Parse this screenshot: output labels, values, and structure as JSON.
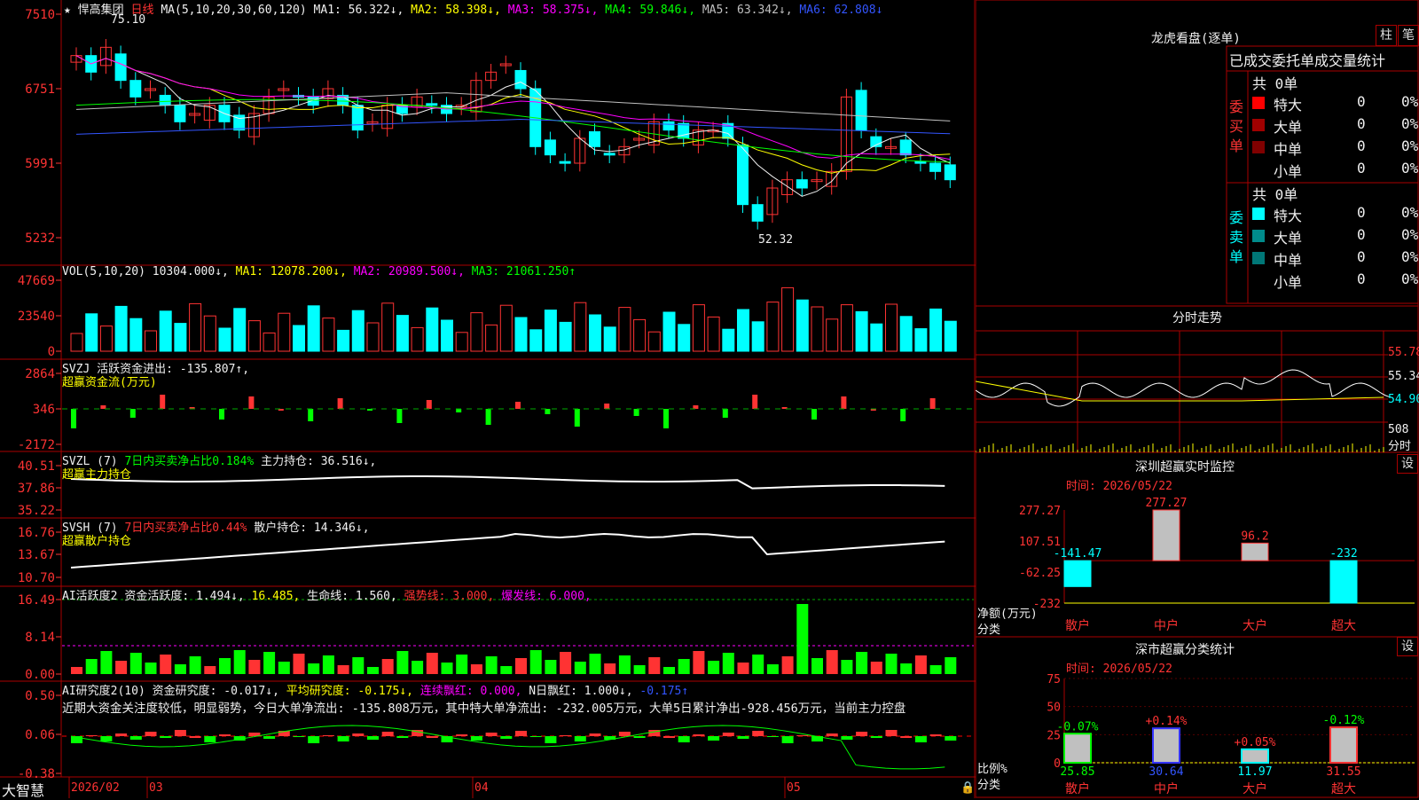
{
  "main_header": {
    "star": "★",
    "stock_name": "悍高集团",
    "period": "日线",
    "ma_label": "MA(5,10,20,30,60,120)",
    "ma_values": [
      {
        "label": "MA1: 56.322↓,",
        "color": "#f0f0f0"
      },
      {
        "label": "MA2: 58.398↓,",
        "color": "#ffff00"
      },
      {
        "label": "MA3: 58.375↓,",
        "color": "#ff00ff"
      },
      {
        "label": "MA4: 59.846↓,",
        "color": "#00ff00"
      },
      {
        "label": "MA5: 63.342↓,",
        "color": "#c0c0c0"
      },
      {
        "label": "MA6: 62.808↓",
        "color": "#3355ff"
      }
    ],
    "high_mark": "75.10",
    "low_mark": "52.32",
    "y_ticks": [
      "7510",
      "6751",
      "5991",
      "5232"
    ]
  },
  "vol_panel": {
    "label": "VOL(5,10,20)",
    "value": "10304.000↓,",
    "ma1": "MA1: 12078.200↓,",
    "ma2": "MA2: 20989.500↓,",
    "ma3": "MA3: 21061.250↑",
    "y_ticks": [
      "47669",
      "23540",
      "0"
    ]
  },
  "svzj_panel": {
    "label": "SVZJ",
    "text": "活跃资金进出: -135.807↑,",
    "subtitle": "超赢资金流(万元)",
    "y_ticks": [
      "2864",
      "346",
      "-2172"
    ]
  },
  "svzl_panel": {
    "label": "SVZL (7)",
    "ratio": "7日内买卖净占比0.184%",
    "hold": "主力持仓: 36.516↓,",
    "subtitle": "超赢主力持仓",
    "y_ticks": [
      "40.51",
      "37.86",
      "35.22"
    ]
  },
  "svsh_panel": {
    "label": "SVSH (7)",
    "ratio": "7日内买卖净占比0.44%",
    "hold": "散户持仓: 14.346↓,",
    "subtitle": "超赢散户持仓",
    "y_ticks": [
      "16.76",
      "13.67",
      "10.70"
    ]
  },
  "ai_act_panel": {
    "label": "AI活跃度2",
    "a": "资金活跃度: 1.494↓,",
    "b": "16.485,",
    "c": "生命线: 1.560,",
    "d": "强势线: 3.000,",
    "e": "爆发线: 6.000,",
    "y_ticks": [
      "16.49",
      "8.14",
      "0.00"
    ]
  },
  "ai_res_panel": {
    "label": "AI研究度2(10)",
    "a": "资金研究度: -0.017↓,",
    "b": "平均研究度: -0.175↓,",
    "c": "连续飘红: 0.000,",
    "d": "N日飘红: 1.000↓,",
    "e": "-0.175↑",
    "summary": "近期大资金关注度较低，明显弱势，今日大单净流出: -135.808万元，其中特大单净流出: -232.005万元，大单5日累计净出-928.456万元，当前主力控盘",
    "y_ticks": [
      "0.50",
      "0.06",
      "-0.38"
    ]
  },
  "bottom_bar": {
    "brand": "大智慧",
    "dates": [
      "2026/02",
      "03",
      "04",
      "05"
    ]
  },
  "right": {
    "title": "龙虎看盘(逐单)",
    "btn1": "柱",
    "btn2": "笔",
    "section_title": "已成交委托单成交量统计",
    "buy_label": "委买单",
    "buy_total": "共 0单",
    "sell_label": "委卖单",
    "sell_total": "共 0单",
    "buy_rows": [
      {
        "name": "特大",
        "count": "0",
        "pct": "0%",
        "color": "#ff0000"
      },
      {
        "name": "大单",
        "count": "0",
        "pct": "0%",
        "color": "#a00000"
      },
      {
        "name": "中单",
        "count": "0",
        "pct": "0%",
        "color": "#800000"
      },
      {
        "name": "小单",
        "count": "0",
        "pct": "0%",
        "color": "#000000"
      }
    ],
    "sell_rows": [
      {
        "name": "特大",
        "count": "0",
        "pct": "0%",
        "color": "#00ffff"
      },
      {
        "name": "大单",
        "count": "0",
        "pct": "0%",
        "color": "#008b8b"
      },
      {
        "name": "中单",
        "count": "0",
        "pct": "0%",
        "color": "#007777"
      },
      {
        "name": "小单",
        "count": "0",
        "pct": "0%",
        "color": "#000000"
      }
    ],
    "intraday_title": "分时走势",
    "intraday_ticks": [
      "55.78",
      "55.34",
      "54.90",
      "508",
      "分时"
    ],
    "sz_monitor_title": "深圳超赢实时监控",
    "sz_monitor_btn": "设",
    "sz_time": "时间: 2026/05/22",
    "sz_yticks": [
      "277.27",
      "107.51",
      "-62.25",
      "-232"
    ],
    "sz_ylabel": "净额(万元)",
    "sz_xlabel": "分类",
    "sz_values": [
      "-141.47",
      "277.27",
      "96.2",
      "-232"
    ],
    "sz_cats": [
      "散户",
      "中户",
      "大户",
      "超大"
    ],
    "stat_title": "深市超赢分类统计",
    "stat_btn": "设",
    "stat_time": "时间: 2026/05/22",
    "stat_yticks": [
      "75",
      "50",
      "25",
      "0"
    ],
    "stat_ylabel": "比例%",
    "stat_xlabel": "分类",
    "stat_changes": [
      "-0.07%",
      "+0.14%",
      "+0.05%",
      "-0.12%"
    ],
    "stat_values": [
      "25.85",
      "30.64",
      "11.97",
      "31.55"
    ],
    "stat_cats": [
      "散户",
      "中户",
      "大户",
      "超大"
    ]
  },
  "chart_data": {
    "type": "bar",
    "title": "深圳超赢实时监控",
    "ylabel": "净额(万元)",
    "xlabel": "分类",
    "categories": [
      "散户",
      "中户",
      "大户",
      "超大"
    ],
    "values": [
      -141.47,
      277.27,
      96.2,
      -232
    ],
    "ylim": [
      -232,
      277.27
    ]
  }
}
